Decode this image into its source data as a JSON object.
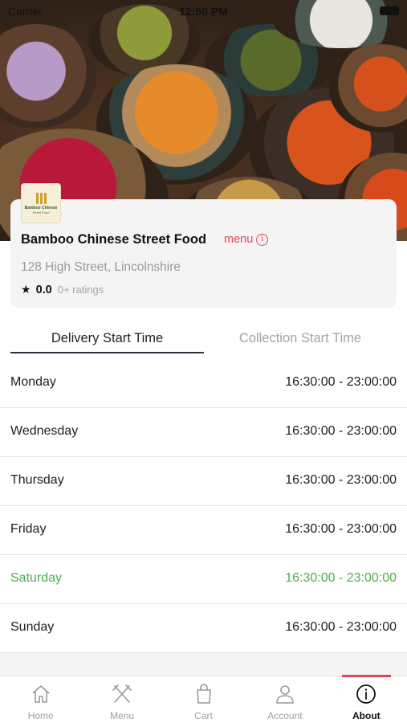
{
  "status_bar": {
    "carrier": "Carrier",
    "time": "12:50 PM"
  },
  "restaurant": {
    "logo_text_1": "Bamboo Chinese",
    "logo_text_2": "Street Food",
    "name": "Bamboo Chinese Street Food",
    "menu_link": "menu",
    "address": "128 High Street, Lincolnshire",
    "rating_score": "0.0",
    "rating_count": "0+ ratings"
  },
  "tabs": [
    {
      "label": "Delivery Start Time",
      "active": true
    },
    {
      "label": "Collection Start Time",
      "active": false
    }
  ],
  "schedule": [
    {
      "day": "Monday",
      "hours": "16:30:00 - 23:00:00"
    },
    {
      "day": "Wednesday",
      "hours": "16:30:00 - 23:00:00"
    },
    {
      "day": "Thursday",
      "hours": "16:30:00 - 23:00:00"
    },
    {
      "day": "Friday",
      "hours": "16:30:00 - 23:00:00"
    },
    {
      "day": "Saturday",
      "hours": "16:30:00 - 23:00:00",
      "highlight": true
    },
    {
      "day": "Sunday",
      "hours": "16:30:00 - 23:00:00"
    }
  ],
  "nav": [
    {
      "label": "Home",
      "icon": "home-icon"
    },
    {
      "label": "Menu",
      "icon": "fork-knife-icon"
    },
    {
      "label": "Cart",
      "icon": "shopping-bag-icon"
    },
    {
      "label": "Account",
      "icon": "person-icon"
    },
    {
      "label": "About",
      "icon": "info-icon",
      "active": true
    }
  ],
  "colors": {
    "accent": "#e0465a",
    "highlight_green": "#4cae4f",
    "tab_underline": "#2d3140"
  }
}
